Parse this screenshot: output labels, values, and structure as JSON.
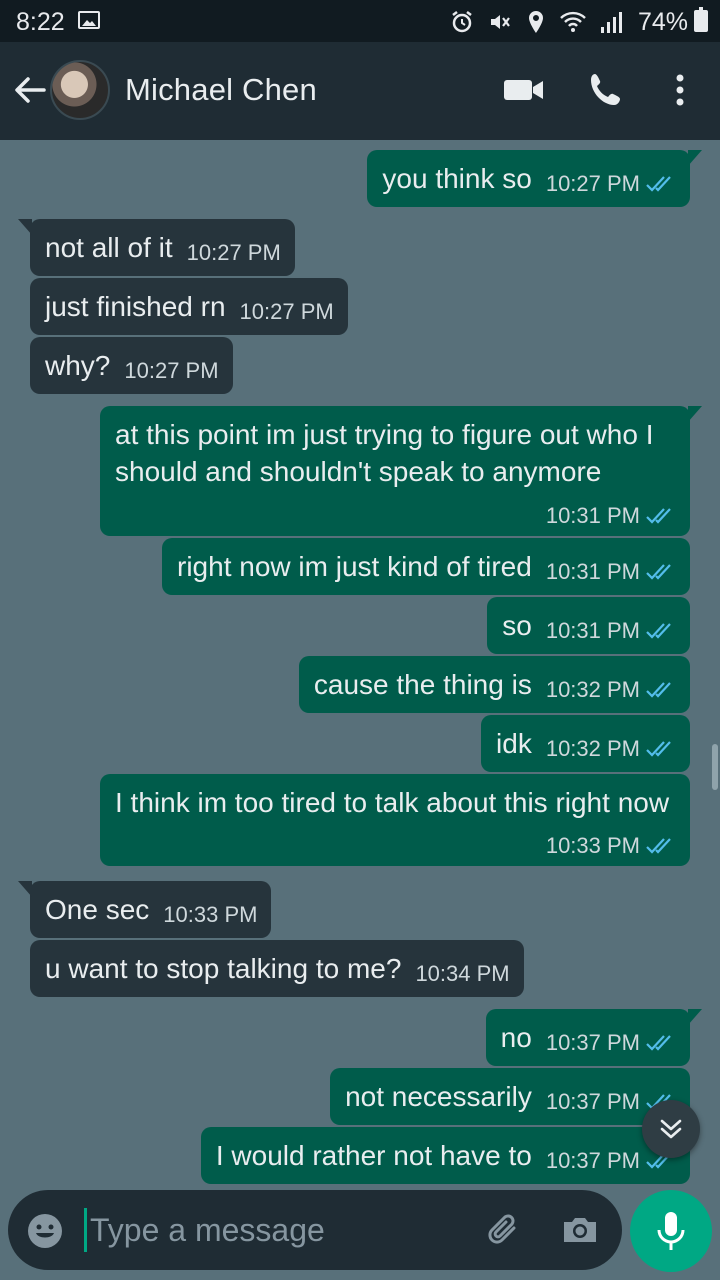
{
  "status_bar": {
    "time": "8:22",
    "battery": "74%"
  },
  "header": {
    "contact_name": "Michael Chen"
  },
  "messages": [
    {
      "dir": "out",
      "text": "you think so",
      "time": "10:27 PM",
      "read": true
    },
    {
      "dir": "in",
      "text": "not all of it",
      "time": "10:27 PM"
    },
    {
      "dir": "in",
      "text": "just finished rn",
      "time": "10:27 PM"
    },
    {
      "dir": "in",
      "text": "why?",
      "time": "10:27 PM"
    },
    {
      "dir": "out",
      "text": "at this point im just trying to figure out who I should and shouldn't speak to anymore",
      "time": "10:31 PM",
      "read": true
    },
    {
      "dir": "out",
      "text": "right now im just kind of tired",
      "time": "10:31 PM",
      "read": true
    },
    {
      "dir": "out",
      "text": "so",
      "time": "10:31 PM",
      "read": true
    },
    {
      "dir": "out",
      "text": "cause the thing is",
      "time": "10:32 PM",
      "read": true
    },
    {
      "dir": "out",
      "text": "idk",
      "time": "10:32 PM",
      "read": true
    },
    {
      "dir": "out",
      "text": "I think im too tired to talk about this right now",
      "time": "10:33 PM",
      "read": true
    },
    {
      "dir": "in",
      "text": "One sec",
      "time": "10:33 PM"
    },
    {
      "dir": "in",
      "text": "u want to stop talking to me?",
      "time": "10:34 PM"
    },
    {
      "dir": "out",
      "text": "no",
      "time": "10:37 PM",
      "read": true
    },
    {
      "dir": "out",
      "text": "not necessarily",
      "time": "10:37 PM",
      "read": true
    },
    {
      "dir": "out",
      "text": "I would rather not have to",
      "time": "10:37 PM",
      "read": true
    }
  ],
  "composer": {
    "placeholder": "Type a message"
  },
  "colors": {
    "chat_bg": "#58707a",
    "incoming_bubble": "#26343c",
    "outgoing_bubble": "#005c4b",
    "accent": "#00a884",
    "read_ticks": "#53bdeb"
  }
}
